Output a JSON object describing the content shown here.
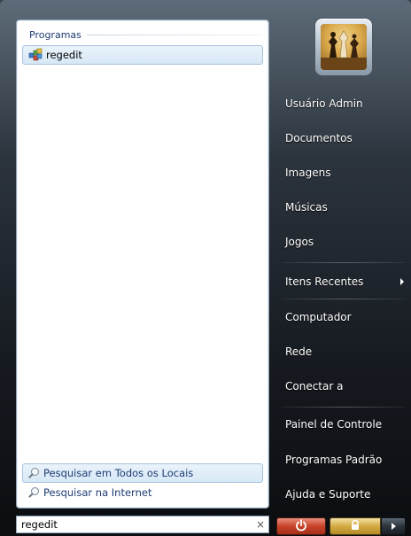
{
  "start_menu": {
    "programs": {
      "header": "Programas",
      "items": [
        {
          "label": "regedit",
          "icon": "regedit-icon"
        }
      ]
    },
    "search_links": [
      {
        "label": "Pesquisar em Todos os Locais",
        "icon": "search-icon",
        "selected": true
      },
      {
        "label": "Pesquisar na Internet",
        "icon": "search-icon",
        "selected": false
      }
    ],
    "search_box": {
      "value": "regedit",
      "clear_symbol": "×"
    },
    "user": {
      "avatar": "chess-pieces-avatar"
    },
    "right_items": [
      {
        "label": "Usuário Admin"
      },
      {
        "label": "Documentos"
      },
      {
        "label": "Imagens"
      },
      {
        "label": "Músicas"
      },
      {
        "label": "Jogos"
      },
      {
        "label": "Itens Recentes",
        "submenu": true
      },
      {
        "label": "Computador"
      },
      {
        "label": "Rede"
      },
      {
        "label": "Conectar a"
      },
      {
        "label": "Painel de Controle"
      },
      {
        "label": "Programas Padrão"
      },
      {
        "label": "Ajuda e Suporte"
      }
    ],
    "buttons": {
      "power_icon": "power-icon",
      "lock_icon": "lock-icon",
      "more_icon": "chevron-right-icon"
    },
    "colors": {
      "power": "#c8442a",
      "lock": "#d4aa43",
      "header_text": "#1e3b73"
    }
  }
}
